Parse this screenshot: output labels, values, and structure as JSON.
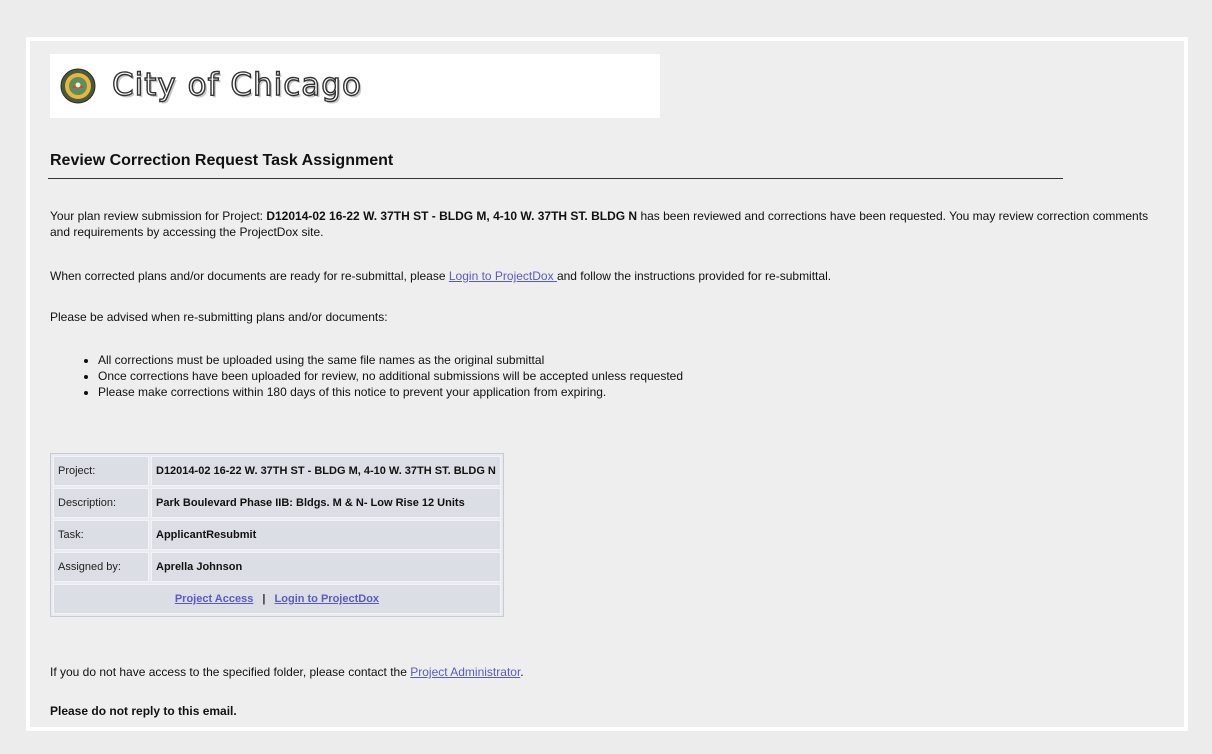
{
  "header": {
    "logo_text": "City of Chicago",
    "title": "Review Correction Request Task Assignment"
  },
  "intro": {
    "prefix": "Your plan review submission for Project: ",
    "project": "D12014-02 16-22 W. 37TH ST - BLDG M, 4-10 W. 37TH ST. BLDG N",
    "suffix": " has been reviewed and corrections have been requested. You may review correction comments and requirements by accessing the ProjectDox site."
  },
  "resubmit": {
    "prefix": "When corrected plans and/or documents are ready for re-submittal, please ",
    "link": "Login to ProjectDox ",
    "suffix": "and follow the instructions provided for re-submittal."
  },
  "advise": "Please be advised when re-submitting plans and/or documents:",
  "bullets": [
    "All corrections must be uploaded using the same file names as the original submittal",
    "Once corrections have been uploaded for review, no additional submissions will be accepted unless requested",
    "Please make corrections within 180 days of this notice to prevent your application from expiring."
  ],
  "info_table": {
    "rows": [
      {
        "label": "Project:",
        "value": "D12014-02 16-22 W. 37TH ST - BLDG M, 4-10 W. 37TH ST. BLDG N"
      },
      {
        "label": "Description:",
        "value": "Park Boulevard Phase IIB: Bldgs. M & N- Low Rise 12 Units"
      },
      {
        "label": "Task:",
        "value": "ApplicantResubmit"
      },
      {
        "label": "Assigned by:",
        "value": "Aprella Johnson"
      }
    ],
    "project_access": "Project Access",
    "separator": "|",
    "login": "Login to ProjectDox"
  },
  "access": {
    "prefix": "If you do not have access to the specified folder, please contact the ",
    "link": "Project Administrator",
    "suffix": "."
  },
  "footer_note": "Please do not reply to this email."
}
